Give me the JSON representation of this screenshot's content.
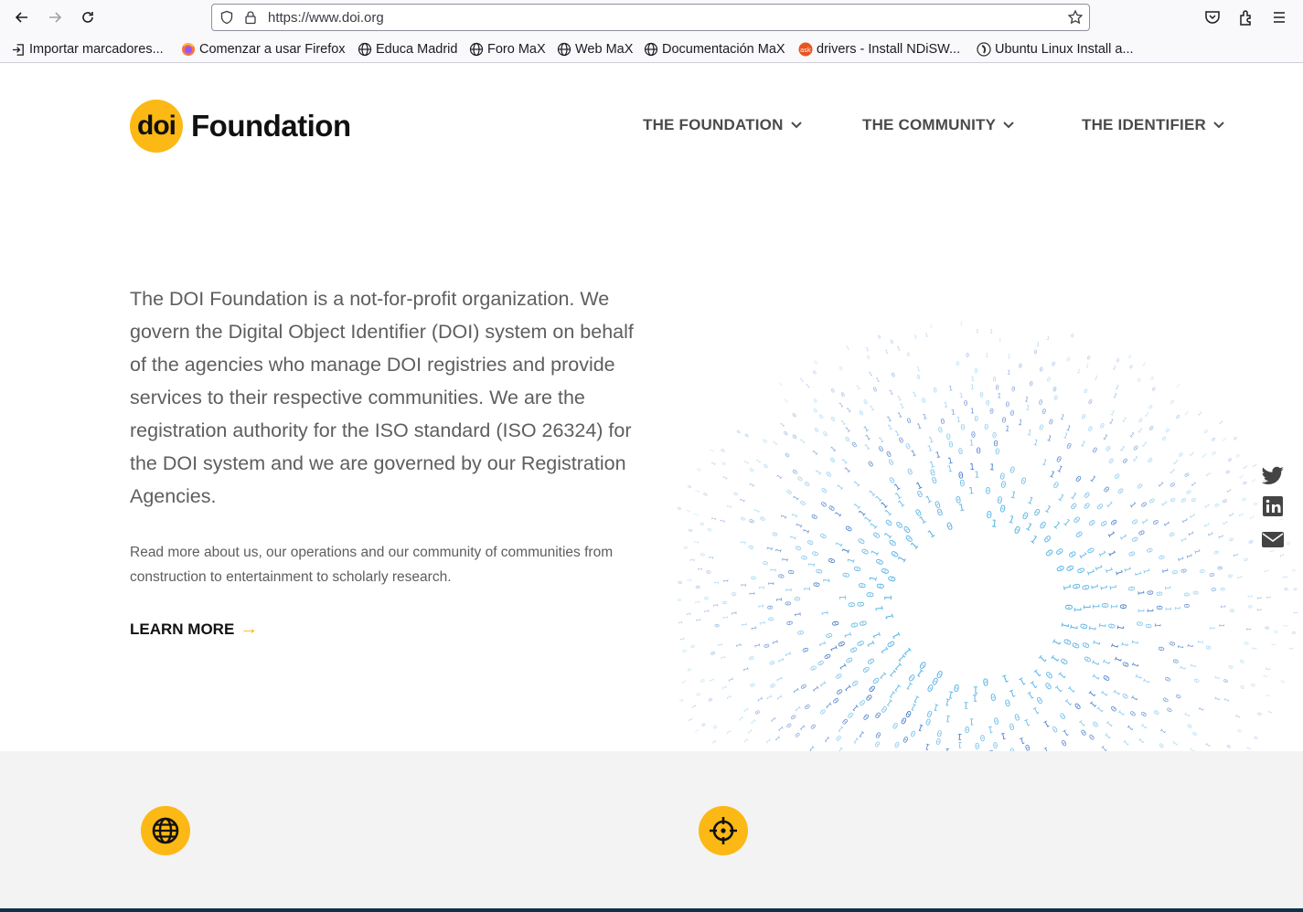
{
  "browser": {
    "url": "https://www.doi.org",
    "bookmarks": [
      {
        "label": "Importar marcadores...",
        "icon": "import-icon"
      },
      {
        "label": "Comenzar a usar Firefox",
        "icon": "firefox-icon"
      },
      {
        "label": "Educa Madrid",
        "icon": "globe-icon"
      },
      {
        "label": "Foro MaX",
        "icon": "globe-icon"
      },
      {
        "label": "Web MaX",
        "icon": "globe-icon"
      },
      {
        "label": "Documentación MaX",
        "icon": "globe-icon"
      },
      {
        "label": "drivers - Install NDiSW...",
        "icon": "askubuntu-icon"
      },
      {
        "label": "Ubuntu Linux Install a...",
        "icon": "site-icon"
      }
    ]
  },
  "site": {
    "logo_mark": "doi",
    "logo_text": "Foundation",
    "nav": [
      {
        "label": "THE FOUNDATION"
      },
      {
        "label": "THE COMMUNITY"
      },
      {
        "label": "THE IDENTIFIER"
      }
    ],
    "intro": "The DOI Foundation is a not-for-profit organization. We govern the Digital Object Identifier (DOI) system on behalf of the agencies who manage DOI registries and provide services to their respective communities. We are the registration authority for the ISO standard (ISO 26324) for the DOI system and we are governed by our Registration Agencies.",
    "sub": "Read more about us, our operations and our community of communities from construction to entertainment to scholarly research.",
    "learn_more": "LEARN MORE",
    "learn_more_arrow": "→",
    "share": [
      "twitter-icon",
      "linkedin-icon",
      "email-icon"
    ],
    "features": [
      "globe-icon",
      "crosshair-icon"
    ]
  },
  "colors": {
    "accent": "#fcb814",
    "text": "#5e5e5e",
    "nav": "#4a4a4a",
    "binary_dark": "#1f5fbf",
    "binary_light": "#5ab4e6"
  }
}
